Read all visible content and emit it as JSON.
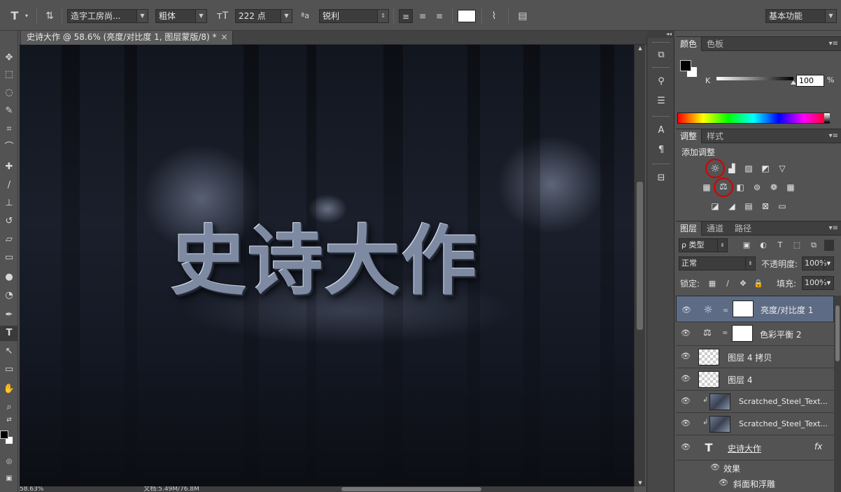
{
  "options_bar": {
    "tool_icon": "type-tool-icon",
    "font_family": "造字工房尚...",
    "font_style": "粗体",
    "font_size": "222 点",
    "aa_label": "ªa",
    "antialias": "锐利",
    "text_color": "#ffffff",
    "workspace": "基本功能"
  },
  "document": {
    "tab_title": "史诗大作 @ 58.6% (亮度/对比度 1, 图层蒙版/8) *",
    "tab_close": "×",
    "art_text": "史诗大作",
    "status_zoom": "58.63%",
    "status_doc": "文档:5.49M/76.8M"
  },
  "color_panel": {
    "tabs": [
      "颜色",
      "色板"
    ],
    "k_label": "K",
    "k_value": "100",
    "k_unit": "%",
    "foreground": "#000000",
    "background": "#ffffff"
  },
  "adjust_panel": {
    "tabs": [
      "调整",
      "样式"
    ],
    "add_label": "添加调整",
    "highlight_color": "#d40000"
  },
  "layers_panel": {
    "tabs": [
      "图层",
      "通道",
      "路径"
    ],
    "kind_filter": "ρ 类型",
    "blend_mode": "正常",
    "opacity_label": "不透明度:",
    "opacity_value": "100%",
    "lock_label": "锁定:",
    "fill_label": "填充:",
    "fill_value": "100%",
    "layers": [
      {
        "name": "亮度/对比度 1",
        "type": "adjustment",
        "icon": "sun-icon",
        "selected": true
      },
      {
        "name": "色彩平衡 2",
        "type": "adjustment",
        "icon": "balance-icon",
        "selected": false
      },
      {
        "name": "图层 4 拷贝",
        "type": "pixel",
        "selected": false
      },
      {
        "name": "图层 4",
        "type": "pixel",
        "selected": false
      },
      {
        "name": "Scratched_Steel_Text...",
        "type": "smart",
        "clipped": true,
        "selected": false
      },
      {
        "name": "Scratched_Steel_Text...",
        "type": "smart",
        "clipped": true,
        "selected": false
      },
      {
        "name": "史诗大作",
        "type": "text",
        "fx": "fx",
        "selected": false
      },
      {
        "name": "效果",
        "type": "effects",
        "selected": false
      },
      {
        "name": "斜面和浮雕",
        "type": "effect",
        "selected": false
      }
    ]
  }
}
